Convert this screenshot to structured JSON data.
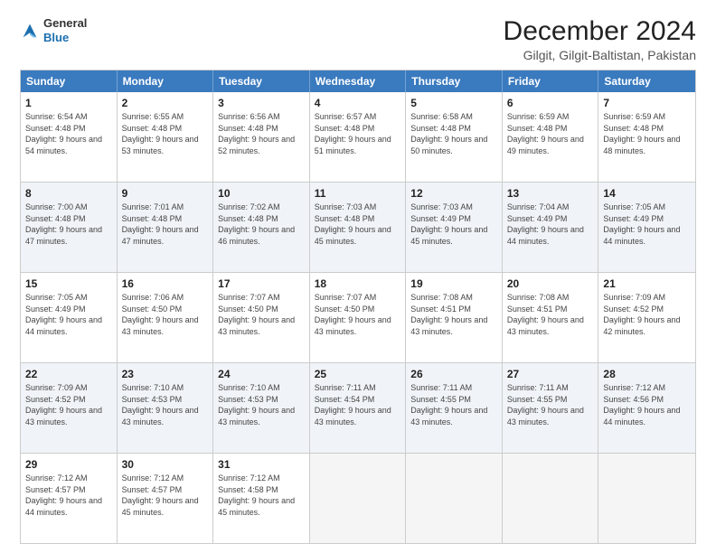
{
  "logo": {
    "general": "General",
    "blue": "Blue"
  },
  "header": {
    "title": "December 2024",
    "subtitle": "Gilgit, Gilgit-Baltistan, Pakistan"
  },
  "days": [
    "Sunday",
    "Monday",
    "Tuesday",
    "Wednesday",
    "Thursday",
    "Friday",
    "Saturday"
  ],
  "weeks": [
    [
      {
        "day": "1",
        "rise": "6:54 AM",
        "set": "4:48 PM",
        "daylight": "9 hours and 54 minutes."
      },
      {
        "day": "2",
        "rise": "6:55 AM",
        "set": "4:48 PM",
        "daylight": "9 hours and 53 minutes."
      },
      {
        "day": "3",
        "rise": "6:56 AM",
        "set": "4:48 PM",
        "daylight": "9 hours and 52 minutes."
      },
      {
        "day": "4",
        "rise": "6:57 AM",
        "set": "4:48 PM",
        "daylight": "9 hours and 51 minutes."
      },
      {
        "day": "5",
        "rise": "6:58 AM",
        "set": "4:48 PM",
        "daylight": "9 hours and 50 minutes."
      },
      {
        "day": "6",
        "rise": "6:59 AM",
        "set": "4:48 PM",
        "daylight": "9 hours and 49 minutes."
      },
      {
        "day": "7",
        "rise": "6:59 AM",
        "set": "4:48 PM",
        "daylight": "9 hours and 48 minutes."
      }
    ],
    [
      {
        "day": "8",
        "rise": "7:00 AM",
        "set": "4:48 PM",
        "daylight": "9 hours and 47 minutes."
      },
      {
        "day": "9",
        "rise": "7:01 AM",
        "set": "4:48 PM",
        "daylight": "9 hours and 47 minutes."
      },
      {
        "day": "10",
        "rise": "7:02 AM",
        "set": "4:48 PM",
        "daylight": "9 hours and 46 minutes."
      },
      {
        "day": "11",
        "rise": "7:03 AM",
        "set": "4:48 PM",
        "daylight": "9 hours and 45 minutes."
      },
      {
        "day": "12",
        "rise": "7:03 AM",
        "set": "4:49 PM",
        "daylight": "9 hours and 45 minutes."
      },
      {
        "day": "13",
        "rise": "7:04 AM",
        "set": "4:49 PM",
        "daylight": "9 hours and 44 minutes."
      },
      {
        "day": "14",
        "rise": "7:05 AM",
        "set": "4:49 PM",
        "daylight": "9 hours and 44 minutes."
      }
    ],
    [
      {
        "day": "15",
        "rise": "7:05 AM",
        "set": "4:49 PM",
        "daylight": "9 hours and 44 minutes."
      },
      {
        "day": "16",
        "rise": "7:06 AM",
        "set": "4:50 PM",
        "daylight": "9 hours and 43 minutes."
      },
      {
        "day": "17",
        "rise": "7:07 AM",
        "set": "4:50 PM",
        "daylight": "9 hours and 43 minutes."
      },
      {
        "day": "18",
        "rise": "7:07 AM",
        "set": "4:50 PM",
        "daylight": "9 hours and 43 minutes."
      },
      {
        "day": "19",
        "rise": "7:08 AM",
        "set": "4:51 PM",
        "daylight": "9 hours and 43 minutes."
      },
      {
        "day": "20",
        "rise": "7:08 AM",
        "set": "4:51 PM",
        "daylight": "9 hours and 43 minutes."
      },
      {
        "day": "21",
        "rise": "7:09 AM",
        "set": "4:52 PM",
        "daylight": "9 hours and 42 minutes."
      }
    ],
    [
      {
        "day": "22",
        "rise": "7:09 AM",
        "set": "4:52 PM",
        "daylight": "9 hours and 43 minutes."
      },
      {
        "day": "23",
        "rise": "7:10 AM",
        "set": "4:53 PM",
        "daylight": "9 hours and 43 minutes."
      },
      {
        "day": "24",
        "rise": "7:10 AM",
        "set": "4:53 PM",
        "daylight": "9 hours and 43 minutes."
      },
      {
        "day": "25",
        "rise": "7:11 AM",
        "set": "4:54 PM",
        "daylight": "9 hours and 43 minutes."
      },
      {
        "day": "26",
        "rise": "7:11 AM",
        "set": "4:55 PM",
        "daylight": "9 hours and 43 minutes."
      },
      {
        "day": "27",
        "rise": "7:11 AM",
        "set": "4:55 PM",
        "daylight": "9 hours and 43 minutes."
      },
      {
        "day": "28",
        "rise": "7:12 AM",
        "set": "4:56 PM",
        "daylight": "9 hours and 44 minutes."
      }
    ],
    [
      {
        "day": "29",
        "rise": "7:12 AM",
        "set": "4:57 PM",
        "daylight": "9 hours and 44 minutes."
      },
      {
        "day": "30",
        "rise": "7:12 AM",
        "set": "4:57 PM",
        "daylight": "9 hours and 45 minutes."
      },
      {
        "day": "31",
        "rise": "7:12 AM",
        "set": "4:58 PM",
        "daylight": "9 hours and 45 minutes."
      },
      null,
      null,
      null,
      null
    ]
  ]
}
